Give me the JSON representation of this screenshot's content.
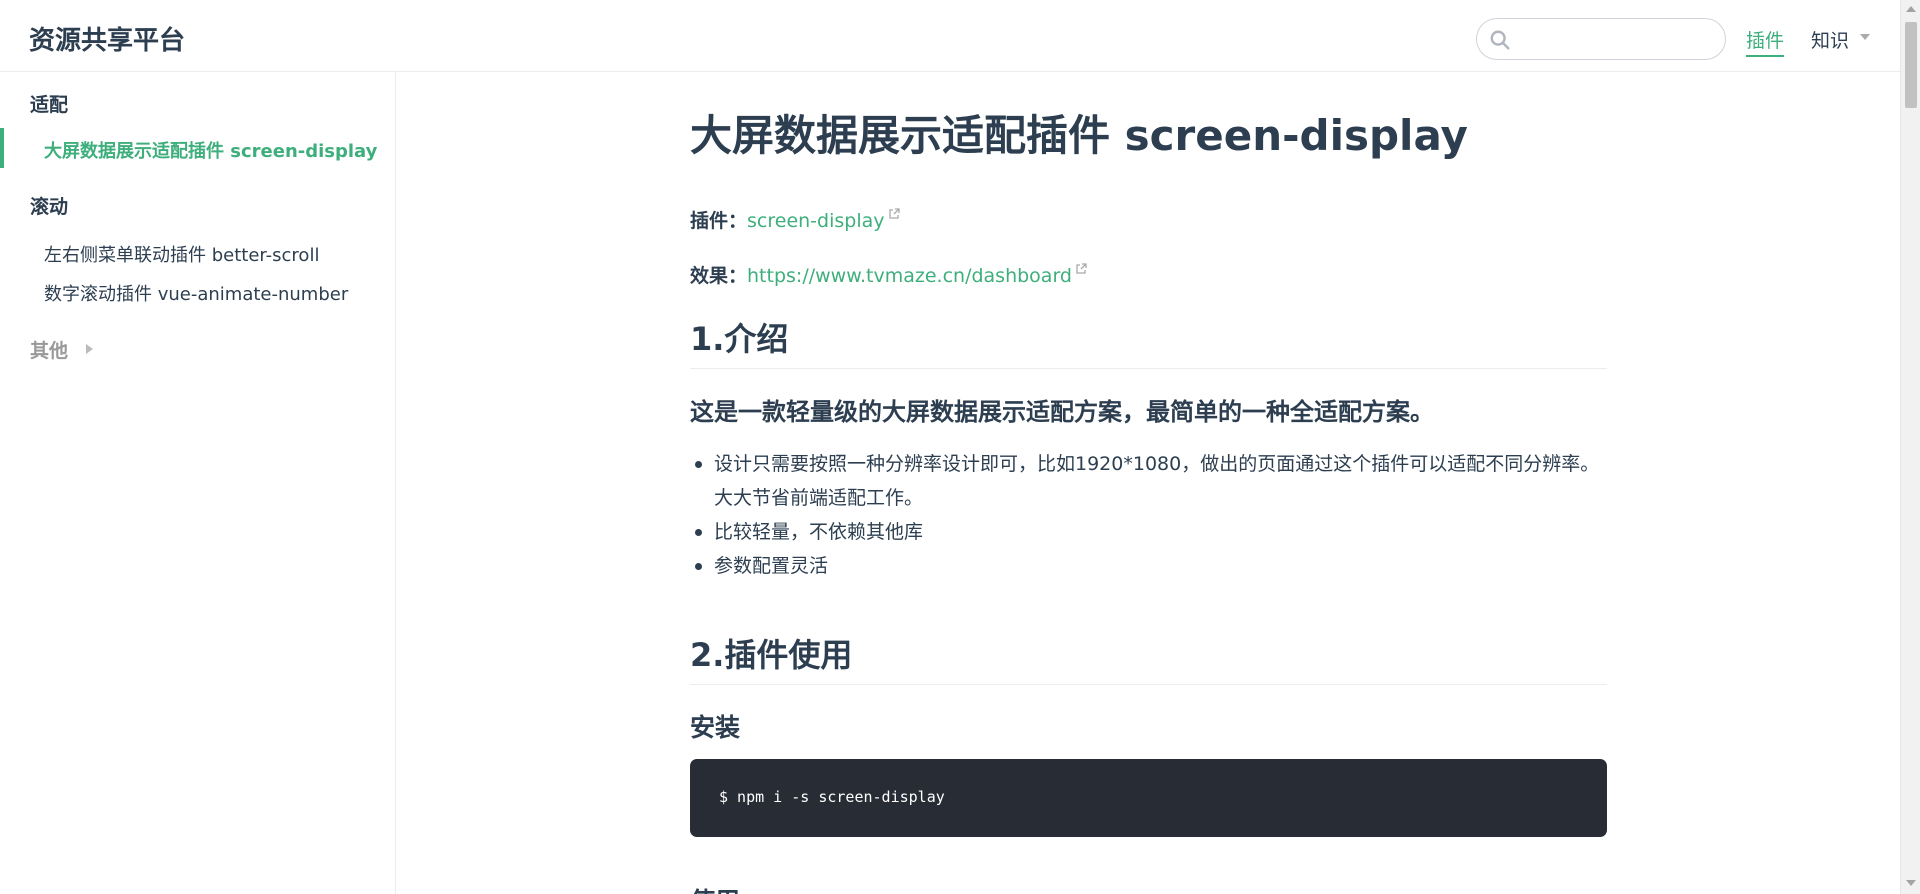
{
  "navbar": {
    "site_title": "资源共享平台",
    "search_placeholder": "",
    "search_icon": "search-icon",
    "links": [
      {
        "label": "插件",
        "active": true
      },
      {
        "label": "知识",
        "dropdown": true
      }
    ]
  },
  "sidebar": {
    "groups": [
      {
        "title": "适配",
        "items": [
          {
            "label": "大屏数据展示适配插件 screen-display",
            "active": true
          }
        ]
      },
      {
        "title": "滚动",
        "items": [
          {
            "label": "左右侧菜单联动插件 better-scroll"
          },
          {
            "label": "数字滚动插件 vue-animate-number"
          }
        ]
      },
      {
        "title": "其他",
        "collapsed": true,
        "items": []
      }
    ]
  },
  "content": {
    "title": "大屏数据展示适配插件 screen-display",
    "meta": [
      {
        "label": "插件：",
        "link": "screen-display"
      },
      {
        "label": "效果：",
        "link": "https://www.tvmaze.cn/dashboard"
      }
    ],
    "section1": {
      "heading": "1.介绍",
      "subheading": "这是一款轻量级的大屏数据展示适配方案，最简单的一种全适配方案。",
      "bullets": [
        "设计只需要按照一种分辨率设计即可，比如1920*1080，做出的页面通过这个插件可以适配不同分辨率。大大节省前端适配工作。",
        "比较轻量，不依赖其他库",
        "参数配置灵活"
      ]
    },
    "section2": {
      "heading": "2.插件使用",
      "install_heading": "安装",
      "install_code": "$ npm i -s screen-display",
      "usage_heading": "使用"
    }
  },
  "colors": {
    "accent": "#3eaf7c",
    "text": "#2c3e50",
    "code_bg": "#282c34"
  }
}
